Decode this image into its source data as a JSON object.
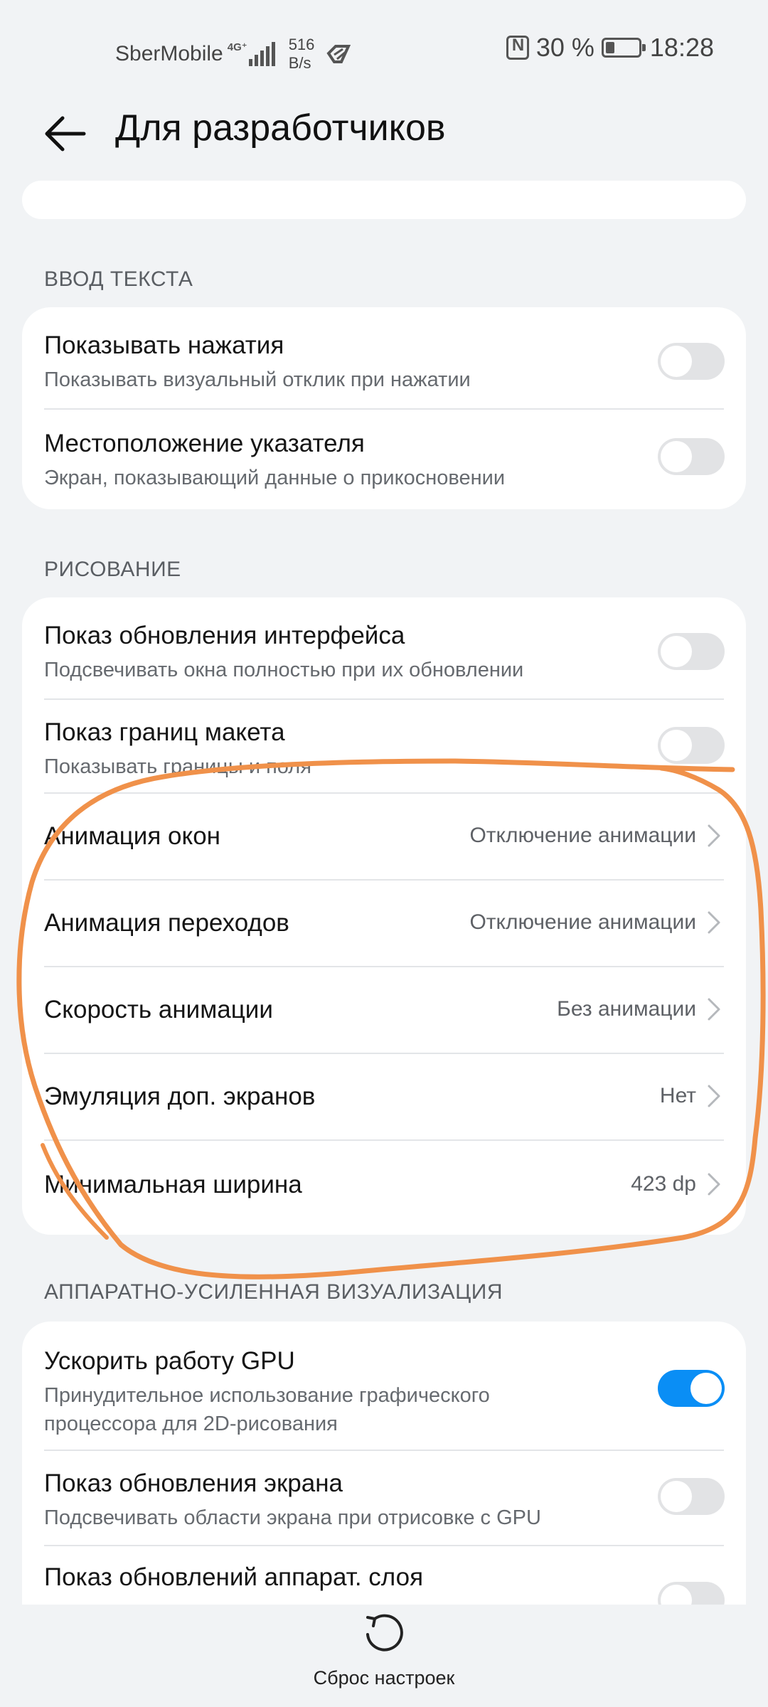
{
  "status_bar": {
    "carrier": "SberMobile",
    "network": "4G⁺",
    "speed_value": "516",
    "speed_unit": "B/s",
    "battery": "30 %",
    "time": "18:28"
  },
  "header": {
    "title": "Для разработчиков"
  },
  "sections": {
    "input": {
      "title": "ВВОД ТЕКСТА",
      "items": [
        {
          "title": "Показывать нажатия",
          "subtitle": "Показывать визуальный отклик при нажатии",
          "enabled": false
        },
        {
          "title": "Местоположение указателя",
          "subtitle": "Экран, показывающий данные о прикосновении",
          "enabled": false
        }
      ]
    },
    "drawing": {
      "title": "РИСОВАНИЕ",
      "toggles": [
        {
          "title": "Показ обновления интерфейса",
          "subtitle": "Подсвечивать окна полностью при их обновлении",
          "enabled": false
        },
        {
          "title": "Показ границ макета",
          "subtitle": "Показывать границы и поля",
          "enabled": false
        }
      ],
      "options": [
        {
          "title": "Анимация окон",
          "value": "Отключение анимации"
        },
        {
          "title": "Анимация переходов",
          "value": "Отключение анимации"
        },
        {
          "title": "Скорость анимации",
          "value": "Без анимации"
        },
        {
          "title": "Эмуляция доп. экранов",
          "value": "Нет"
        },
        {
          "title": "Минимальная ширина",
          "value": "423 dp"
        }
      ]
    },
    "hw": {
      "title": "АППАРАТНО-УСИЛЕННАЯ ВИЗУАЛИЗАЦИЯ",
      "items": [
        {
          "title": "Ускорить работу GPU",
          "subtitle_line1": "Принудительное использование графического",
          "subtitle_line2": "процессора для 2D-рисования",
          "enabled": true
        },
        {
          "title": "Показ обновления экрана",
          "subtitle": "Подсвечивать области экрана при отрисовке с GPU",
          "enabled": false
        },
        {
          "title": "Показ обновлений аппарат. слоя",
          "enabled": false
        }
      ]
    }
  },
  "bottom": {
    "reset_label": "Сброс настроек"
  },
  "colors": {
    "background": "#f1f3f5",
    "card": "#ffffff",
    "accent": "#0a8ef5",
    "annotation": "#f0914a"
  },
  "icons": [
    "back-arrow-icon",
    "chevron-right-icon",
    "reset-icon",
    "nfc-icon",
    "battery-icon",
    "signal-icon",
    "data-saver-icon"
  ]
}
